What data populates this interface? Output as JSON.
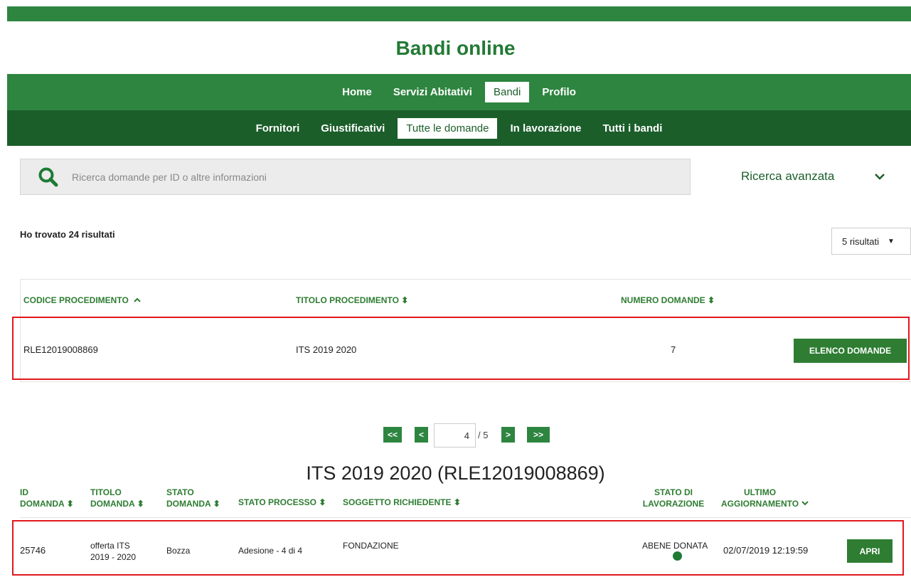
{
  "site": {
    "title": "Bandi online"
  },
  "nav_main": [
    "Home",
    "Servizi Abitativi",
    "Bandi",
    "Profilo"
  ],
  "nav_sub": [
    "Fornitori",
    "Giustificativi",
    "Tutte le domande",
    "In lavorazione",
    "Tutti i bandi"
  ],
  "search": {
    "placeholder": "Ricerca domande per ID o altre informazioni",
    "advanced_label": "Ricerca avanzata"
  },
  "results": {
    "summary": "Ho trovato 24 risultati",
    "page_size": "5 risultati"
  },
  "procedures": {
    "headers": [
      "CODICE PROCEDIMENTO",
      "TITOLO PROCEDIMENTO",
      "NUMERO DOMANDE"
    ],
    "row": {
      "code": "RLE12019008869",
      "title": "ITS 2019 2020",
      "count": "7",
      "action": "ELENCO DOMANDE"
    }
  },
  "pager": {
    "first": "<<",
    "prev": "<",
    "current": "4",
    "total": "/ 5",
    "next": ">",
    "last": ">>"
  },
  "section": {
    "title": "ITS 2019 2020 (RLE12019008869)"
  },
  "applications": {
    "headers": {
      "id": [
        "ID",
        "DOMANDA"
      ],
      "title": [
        "TITOLO",
        "DOMANDA"
      ],
      "state": [
        "STATO",
        "DOMANDA"
      ],
      "process": "STATO PROCESSO",
      "applicant": "SOGGETTO RICHIEDENTE",
      "work": [
        "STATO DI",
        "LAVORAZIONE"
      ],
      "updated": [
        "ULTIMO",
        "AGGIORNAMENTO"
      ]
    },
    "row": {
      "id": "25746",
      "title": [
        "offerta ITS",
        "2019 - 2020"
      ],
      "state": "Bozza",
      "process": "Adesione - 4 di 4",
      "applicant": "FONDAZIONE",
      "work": "ABENE DONATA",
      "updated": "02/07/2019 12:19:59",
      "action": "APRI"
    }
  },
  "colors": {
    "green": "#2e8540",
    "dark_green": "#1b5e2a",
    "highlight": "#e2171c"
  },
  "icons": {
    "search": "search-icon",
    "advanced": "chevron-down-icon",
    "sort": "sort-icon",
    "status": "status-dot-icon"
  }
}
